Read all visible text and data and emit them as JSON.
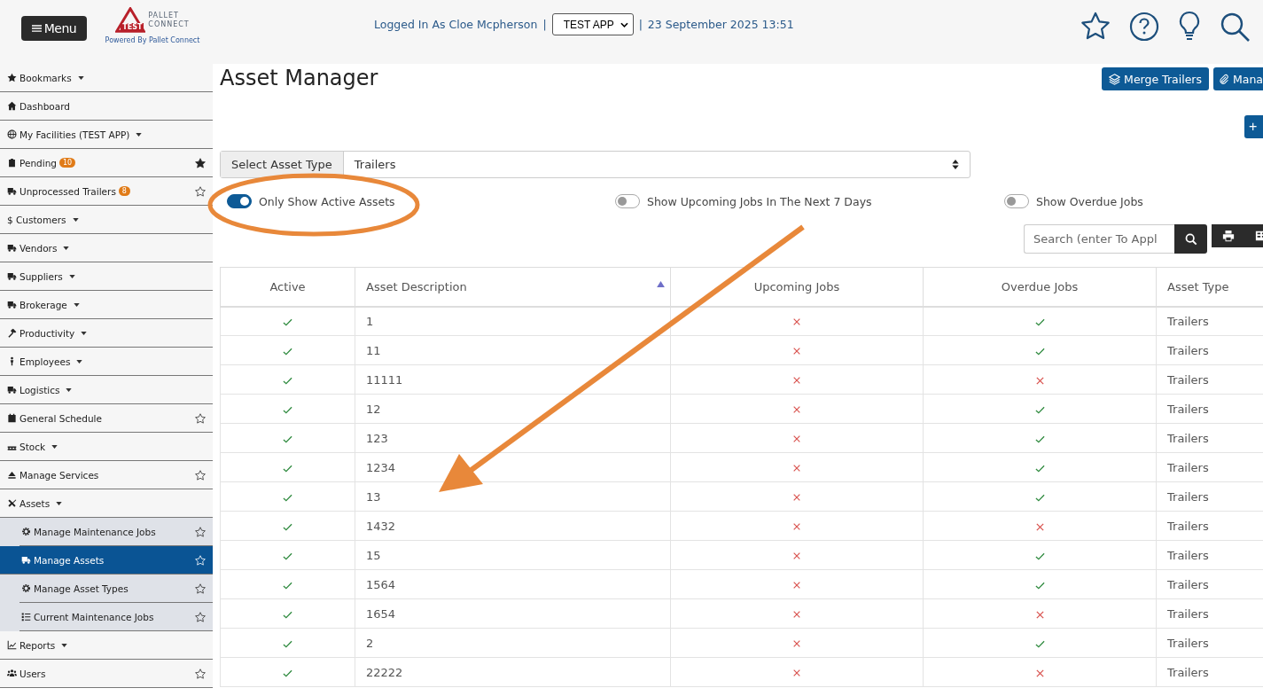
{
  "header": {
    "menu_button": "Menu",
    "logo": {
      "line_1": "PALLET",
      "line_2": "CONNECT",
      "badge": "TEST",
      "tagline": "Powered By Pallet Connect"
    },
    "logged_in": "Logged In As Cloe Mcpherson",
    "separator_1": "|",
    "app_select": "TEST APP",
    "separator_2": "|",
    "datetime": "23 September 2025 13:51"
  },
  "sidebar": {
    "items": [
      {
        "label": "Bookmarks",
        "dropdown": true,
        "selected": false
      },
      {
        "label": "Dashboard",
        "dropdown": false,
        "selected": false
      },
      {
        "label": "My Facilities (TEST APP)",
        "dropdown": true,
        "selected": false
      },
      {
        "label": "Pending",
        "badge": "10",
        "dropdown": false,
        "starred": true,
        "selected": false
      },
      {
        "label": "Unprocessed Trailers",
        "badge": "8",
        "dropdown": false,
        "starred": false,
        "selected": false
      },
      {
        "label": "$ Customers",
        "dropdown": true,
        "selected": false
      },
      {
        "label": "Vendors",
        "dropdown": true,
        "selected": false
      },
      {
        "label": "Suppliers",
        "dropdown": true,
        "selected": false
      },
      {
        "label": "Brokerage",
        "dropdown": true,
        "selected": false
      },
      {
        "label": "Productivity",
        "dropdown": true,
        "selected": false
      },
      {
        "label": "Employees",
        "dropdown": true,
        "selected": false
      },
      {
        "label": "Logistics",
        "dropdown": true,
        "selected": false
      },
      {
        "label": "General Schedule",
        "dropdown": false,
        "starred": false,
        "selected": false
      },
      {
        "label": "Stock",
        "dropdown": true,
        "selected": false
      },
      {
        "label": "Manage Services",
        "dropdown": false,
        "starred": false,
        "selected": false
      },
      {
        "label": "Assets",
        "dropdown": true,
        "selected": false,
        "expanded": true,
        "children": [
          {
            "label": "Manage Maintenance Jobs",
            "starred": false,
            "selected": false
          },
          {
            "label": "Manage Assets",
            "starred": false,
            "selected": true
          },
          {
            "label": "Manage Asset Types",
            "starred": false,
            "selected": false
          },
          {
            "label": "Current Maintenance Jobs",
            "starred": false,
            "selected": false
          }
        ]
      },
      {
        "label": "Reports",
        "dropdown": true,
        "selected": false
      },
      {
        "label": "Users",
        "dropdown": false,
        "starred": false,
        "selected": false
      }
    ]
  },
  "main": {
    "title": "Asset Manager",
    "buttons": [
      {
        "label": "Merge Trailers"
      },
      {
        "label": "Mana"
      }
    ],
    "add_button": "+",
    "asset_type": {
      "label": "Select Asset Type",
      "value": "Trailers"
    },
    "toggles": [
      {
        "label": "Only Show Active Assets",
        "on": true
      },
      {
        "label": "Show Upcoming Jobs In The Next 7 Days",
        "on": false
      },
      {
        "label": "Show Overdue Jobs",
        "on": false
      }
    ],
    "search": {
      "placeholder": "Search (enter To Appl"
    },
    "table": {
      "columns": [
        {
          "label": "Active",
          "sorted": false
        },
        {
          "label": "Asset Description",
          "sorted": true
        },
        {
          "label": "Upcoming Jobs",
          "sorted": false
        },
        {
          "label": "Overdue Jobs",
          "sorted": false
        },
        {
          "label": "Asset Type",
          "sorted": false
        }
      ],
      "rows": [
        {
          "active": true,
          "description": "1",
          "upcoming": false,
          "overdue": true,
          "type": "Trailers"
        },
        {
          "active": true,
          "description": "11",
          "upcoming": false,
          "overdue": true,
          "type": "Trailers"
        },
        {
          "active": true,
          "description": "11111",
          "upcoming": false,
          "overdue": false,
          "type": "Trailers"
        },
        {
          "active": true,
          "description": "12",
          "upcoming": false,
          "overdue": true,
          "type": "Trailers"
        },
        {
          "active": true,
          "description": "123",
          "upcoming": false,
          "overdue": true,
          "type": "Trailers"
        },
        {
          "active": true,
          "description": "1234",
          "upcoming": false,
          "overdue": true,
          "type": "Trailers"
        },
        {
          "active": true,
          "description": "13",
          "upcoming": false,
          "overdue": true,
          "type": "Trailers"
        },
        {
          "active": true,
          "description": "1432",
          "upcoming": false,
          "overdue": false,
          "type": "Trailers"
        },
        {
          "active": true,
          "description": "15",
          "upcoming": false,
          "overdue": true,
          "type": "Trailers"
        },
        {
          "active": true,
          "description": "1564",
          "upcoming": false,
          "overdue": true,
          "type": "Trailers"
        },
        {
          "active": true,
          "description": "1654",
          "upcoming": false,
          "overdue": false,
          "type": "Trailers"
        },
        {
          "active": true,
          "description": "2",
          "upcoming": false,
          "overdue": true,
          "type": "Trailers"
        },
        {
          "active": true,
          "description": "22222",
          "upcoming": false,
          "overdue": false,
          "type": "Trailers"
        }
      ]
    }
  },
  "annotations": {
    "ellipse": {
      "color": "#e8883a"
    },
    "arrow": {
      "color": "#e8883a"
    }
  }
}
